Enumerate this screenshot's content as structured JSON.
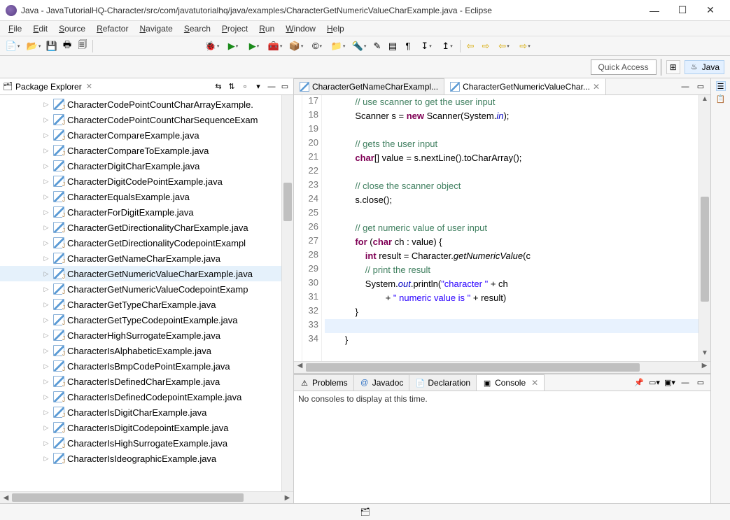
{
  "window": {
    "title": "Java - JavaTutorialHQ-Character/src/com/javatutorialhq/java/examples/CharacterGetNumericValueCharExample.java - Eclipse"
  },
  "menu": {
    "items": [
      "File",
      "Edit",
      "Source",
      "Refactor",
      "Navigate",
      "Search",
      "Project",
      "Run",
      "Window",
      "Help"
    ]
  },
  "quick_access": {
    "label": "Quick Access"
  },
  "perspective": {
    "label_java": "Java"
  },
  "package_explorer": {
    "title": "Package Explorer",
    "items": [
      "CharacterCodePointCountCharArrayExample.",
      "CharacterCodePointCountCharSequenceExam",
      "CharacterCompareExample.java",
      "CharacterCompareToExample.java",
      "CharacterDigitCharExample.java",
      "CharacterDigitCodePointExample.java",
      "CharacterEqualsExample.java",
      "CharacterForDigitExample.java",
      "CharacterGetDirectionalityCharExample.java",
      "CharacterGetDirectionalityCodepointExampl",
      "CharacterGetNameCharExample.java",
      "CharacterGetNumericValueCharExample.java",
      "CharacterGetNumericValueCodepointExamp",
      "CharacterGetTypeCharExample.java",
      "CharacterGetTypeCodepointExample.java",
      "CharacterHighSurrogateExample.java",
      "CharacterIsAlphabeticExample.java",
      "CharacterIsBmpCodePointExample.java",
      "CharacterIsDefinedCharExample.java",
      "CharacterIsDefinedCodepointExample.java",
      "CharacterIsDigitCharExample.java",
      "CharacterIsDigitCodepointExample.java",
      "CharacterIsHighSurrogateExample.java",
      "CharacterIsIdeographicExample.java"
    ],
    "selected_index": 11
  },
  "editor": {
    "tabs": [
      {
        "label": "CharacterGetNameCharExampl..."
      },
      {
        "label": "CharacterGetNumericValueChar..."
      }
    ],
    "active_tab": 1,
    "first_line_no": 17,
    "lines": [
      {
        "t": "cmt",
        "indent": 12,
        "raw": "// use scanner to get the user input"
      },
      {
        "t": "code",
        "indent": 12,
        "tokens": [
          [
            "",
            "Scanner s = "
          ],
          [
            "kw",
            "new"
          ],
          [
            "",
            " Scanner(System."
          ],
          [
            "fld",
            "in"
          ],
          [
            "",
            ");"
          ]
        ]
      },
      {
        "t": "blank"
      },
      {
        "t": "cmt",
        "indent": 12,
        "raw": "// gets the user input"
      },
      {
        "t": "code",
        "indent": 12,
        "tokens": [
          [
            "kw",
            "char"
          ],
          [
            "",
            "[] value = s.nextLine().toCharArray();"
          ]
        ]
      },
      {
        "t": "blank"
      },
      {
        "t": "cmt",
        "indent": 12,
        "raw": "// close the scanner object"
      },
      {
        "t": "code",
        "indent": 12,
        "tokens": [
          [
            "",
            "s.close();"
          ]
        ]
      },
      {
        "t": "blank"
      },
      {
        "t": "cmt",
        "indent": 12,
        "raw": "// get numeric value of user input"
      },
      {
        "t": "code",
        "indent": 12,
        "tokens": [
          [
            "kw",
            "for"
          ],
          [
            "",
            " ("
          ],
          [
            "kw",
            "char"
          ],
          [
            "",
            " ch : value) {"
          ]
        ]
      },
      {
        "t": "code",
        "indent": 16,
        "tokens": [
          [
            "kw",
            "int"
          ],
          [
            "",
            " result = Character."
          ],
          [
            "mtd",
            "getNumericValue"
          ],
          [
            "",
            "(c"
          ]
        ]
      },
      {
        "t": "cmt",
        "indent": 16,
        "raw": "// print the result"
      },
      {
        "t": "code",
        "indent": 16,
        "tokens": [
          [
            "",
            "System."
          ],
          [
            "fld",
            "out"
          ],
          [
            "",
            ".println("
          ],
          [
            "str",
            "\"character \""
          ],
          [
            "",
            " + ch"
          ]
        ]
      },
      {
        "t": "code",
        "indent": 24,
        "tokens": [
          [
            "",
            "+ "
          ],
          [
            "str",
            "\" numeric value is \""
          ],
          [
            "",
            " + result)"
          ]
        ]
      },
      {
        "t": "code",
        "indent": 12,
        "tokens": [
          [
            "",
            "}"
          ]
        ]
      },
      {
        "t": "cursor"
      },
      {
        "t": "code",
        "indent": 8,
        "tokens": [
          [
            "",
            "}"
          ]
        ]
      }
    ]
  },
  "bottom": {
    "tabs": [
      "Problems",
      "Javadoc",
      "Declaration",
      "Console"
    ],
    "active_tab": 3,
    "console_empty": "No consoles to display at this time."
  }
}
